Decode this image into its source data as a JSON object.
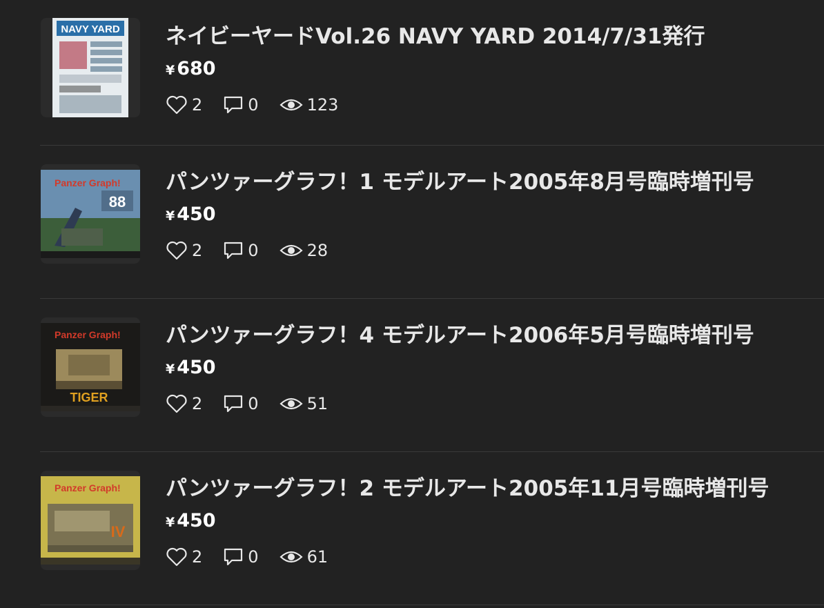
{
  "items": [
    {
      "title": "ネイビーヤードVol.26 NAVY YARD 2014/7/31発行",
      "currency": "¥",
      "price": "680",
      "likes": "2",
      "comments": "0",
      "views": "123",
      "cover_text": "NAVY YARD",
      "cover_colors": [
        "#e7ecef",
        "#2a6fa8",
        "#b34a5a"
      ]
    },
    {
      "title": "パンツァーグラフ！1 モデルアート2005年8月号臨時増刊号",
      "currency": "¥",
      "price": "450",
      "likes": "2",
      "comments": "0",
      "views": "28",
      "cover_text": "88",
      "cover_colors": [
        "#6a8fb0",
        "#3c5e3a",
        "#2e3b52"
      ]
    },
    {
      "title": "パンツァーグラフ！4 モデルアート2006年5月号臨時増刊号",
      "currency": "¥",
      "price": "450",
      "likes": "2",
      "comments": "0",
      "views": "51",
      "cover_text": "TIGER",
      "cover_colors": [
        "#1b1a18",
        "#9c8a5c",
        "#e0a020"
      ]
    },
    {
      "title": "パンツァーグラフ！2 モデルアート2005年11月号臨時増刊号",
      "currency": "¥",
      "price": "450",
      "likes": "2",
      "comments": "0",
      "views": "61",
      "cover_text": "IV",
      "cover_colors": [
        "#c7b64a",
        "#7b7252",
        "#d86a1a"
      ]
    }
  ]
}
